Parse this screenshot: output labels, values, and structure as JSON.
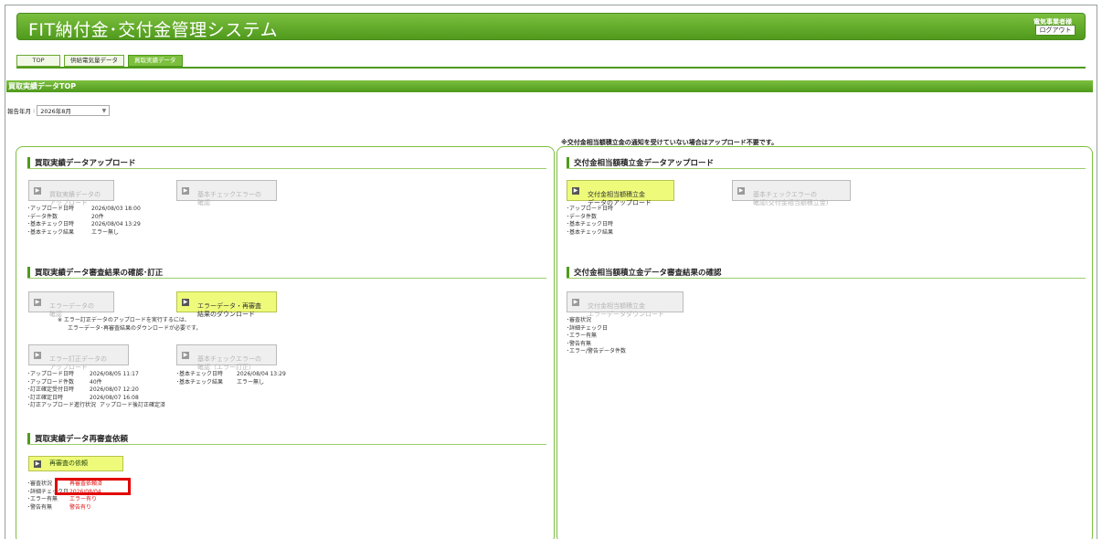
{
  "header": {
    "title": "FIT納付金･交付金管理システム",
    "user": "電気事業者様",
    "logout": "ログアウト"
  },
  "tabs": [
    {
      "label": "TOP"
    },
    {
      "label": "供給電気量データ"
    },
    {
      "label": "買取実績データ"
    }
  ],
  "page_title": "買取実績データTOP",
  "period": {
    "label": "報告年月",
    "value": "2026年8月"
  },
  "notice": "※交付金相当額積立金の通知を受けていない場合はアップロード不要です。",
  "left": {
    "upload": {
      "title": "買取実績データアップロード",
      "btn1": "買取実績データの\nアップロード",
      "btn2": "基本チェックエラーの\n確認",
      "info": [
        {
          "k": "･アップロード日時",
          "v": "2026/08/03 18:00"
        },
        {
          "k": "･データ件数",
          "v": "20件"
        },
        {
          "k": "･基本チェック日時",
          "v": "2026/08/04 13:29"
        },
        {
          "k": "･基本チェック結果",
          "v": "エラー無し"
        }
      ]
    },
    "review": {
      "title": "買取実績データ審査結果の確認･訂正",
      "btn1": "エラーデータの\n確認",
      "btn2": "エラーデータ・再審査\n結果のダウンロード",
      "note1": "※ エラー訂正データのアップロードを実行するには、",
      "note2": "エラーデータ･再審査結果のダウンロードが必要です。",
      "btn3": "エラー訂正データの\nアップロード",
      "btn4": "基本チェックエラーの\n確認（エラー訂正）",
      "info_left": [
        {
          "k": "･アップロード日時",
          "v": "2026/08/05 11:17"
        },
        {
          "k": "･アップロード件数",
          "v": "40件"
        },
        {
          "k": "･訂正確定受付日時",
          "v": "2026/08/07 12:20"
        },
        {
          "k": "･訂正確定日時",
          "v": "2026/08/07 16:08"
        },
        {
          "k": "･訂正アップロード進行状況",
          "v": "アップロード後訂正確定済"
        }
      ],
      "info_right": [
        {
          "k": "･基本チェック日時",
          "v": "2026/08/04 13:29"
        },
        {
          "k": "･基本チェック結果",
          "v": "エラー無し"
        }
      ]
    },
    "rereview": {
      "title": "買取実績データ再審査依頼",
      "btn": "再審査の依頼",
      "info": [
        {
          "k": "･審査状況",
          "v": "再審査依頼済"
        },
        {
          "k": "･詳細チェック日",
          "v": "2026/08/04"
        },
        {
          "k": "･エラー有無",
          "v": "エラー有り"
        },
        {
          "k": "･警告有無",
          "v": "警告有り"
        }
      ]
    }
  },
  "right": {
    "upload": {
      "title": "交付金相当額積立金データアップロード",
      "btn1": "交付金相当額積立金\nデータのアップロード",
      "btn2": "基本チェックエラーの\n確認(交付金相当額積立金)",
      "info": [
        "･アップロード日時",
        "･データ件数",
        "･基本チェック日時",
        "･基本チェック結果"
      ]
    },
    "review": {
      "title": "交付金相当額積立金データ審査結果の確認",
      "btn1": "交付金相当額積立金\nエラーデータダウンロード",
      "info": [
        "･審査状況",
        "･詳細チェック日",
        "･エラー有無",
        "･警告有無",
        "･エラー/警告データ件数"
      ]
    }
  },
  "colors": {
    "brand": "#5aa528",
    "button_active": "#eefb7a",
    "highlight": "#e10000",
    "error_text": "#dd1111"
  }
}
